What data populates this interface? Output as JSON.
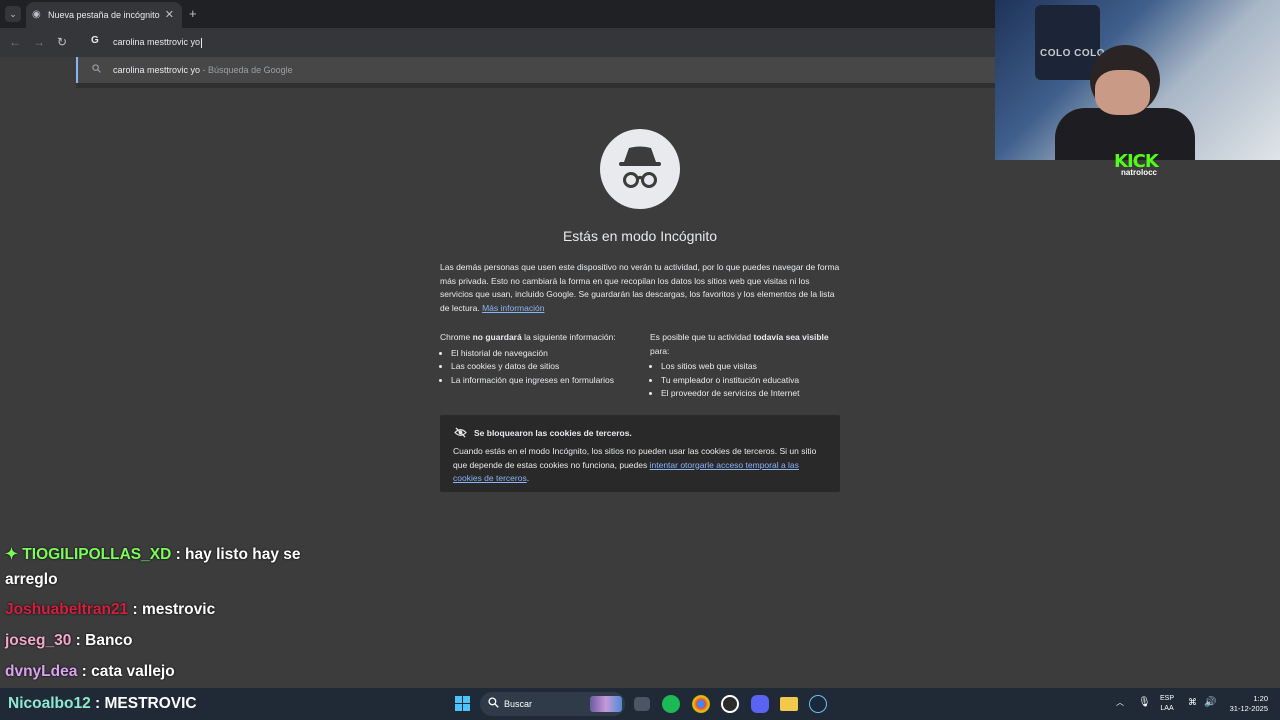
{
  "browser": {
    "tab_title": "Nueva pestaña de incógnito",
    "omnibox_value": "carolina mesttrovic yo",
    "suggestion": {
      "query": "carolina mesttrovic yo",
      "source": " - Búsqueda de Google"
    }
  },
  "incognito": {
    "title": "Estás en modo Incógnito",
    "description": "Las demás personas que usen este dispositivo no verán tu actividad, por lo que puedes navegar de forma más privada. Esto no cambiará la forma en que recopilan los datos los sitios web que visitas ni los servicios que usan, incluido Google. Se guardarán las descargas, los favoritos y los elementos de la lista de lectura.",
    "more_info": "Más información",
    "left_heading_pre": "Chrome ",
    "left_heading_bold": "no guardará",
    "left_heading_post": " la siguiente información:",
    "left_items": [
      "El historial de navegación",
      "Las cookies y datos de sitios",
      "La información que ingreses en formularios"
    ],
    "right_heading_pre": "Es posible que tu actividad ",
    "right_heading_bold": "todavía sea visible",
    "right_heading_post": " para:",
    "right_items": [
      "Los sitios web que visitas",
      "Tu empleador o institución educativa",
      "El proveedor de servicios de Internet"
    ],
    "cookie_title": "Se bloquearon las cookies de terceros.",
    "cookie_text": "Cuando estás en el modo Incógnito, los sitios no pueden usar las cookies de terceros. Si un sitio que depende de estas cookies no funciona, puedes ",
    "cookie_link": "intentar otorgarle acceso temporal a las cookies de terceros",
    "cookie_end": "."
  },
  "webcam": {
    "flag_text": "COLO COLO",
    "kick_logo": "KICK",
    "kick_user": "natrolocc"
  },
  "chat": [
    {
      "user": "TIOGILIPOLLAS_XD",
      "message": " : hay listo hay se",
      "color": "#7cfc5a"
    },
    {
      "user": "",
      "message": "arreglo",
      "color": "#ffffff"
    },
    {
      "user": "Joshuabeltran21",
      "message": " : mestrovic",
      "color": "#d61f3c"
    },
    {
      "user": "joseg_30",
      "message": " : Banco",
      "color": "#f4a8c8"
    },
    {
      "user": "dvnyLdea",
      "message": " : cata vallejo",
      "color": "#d9a3f0"
    }
  ],
  "taskbar": {
    "chat_user": "Nicoalbo12",
    "chat_message": " : MESTROVIC",
    "chat_color": "#8ee8d0",
    "search_label": "Buscar",
    "lang_top": "ESP",
    "lang_bottom": "LAA",
    "time": "1:20",
    "date": "31-12-2025"
  }
}
